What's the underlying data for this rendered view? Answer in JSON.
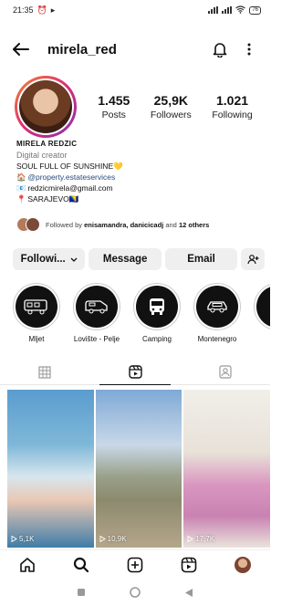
{
  "status_bar": {
    "time": "21:35",
    "battery": "76"
  },
  "header": {
    "username": "mirela_red"
  },
  "stats": [
    {
      "value": "1.455",
      "label": "Posts"
    },
    {
      "value": "25,9K",
      "label": "Followers"
    },
    {
      "value": "1.021",
      "label": "Following"
    }
  ],
  "bio": {
    "name": "MIRELA REDZIC",
    "category": "Digital creator",
    "tagline": "SOUL FULL OF SUNSHINE💛",
    "property_link": "@property.estateservices",
    "email": "redzicmirela@gmail.com",
    "location": "SARAJEVO🇧🇦"
  },
  "followed_by": {
    "prefix": "Followed by",
    "names": "enisamandra, danicicadj",
    "middle": "and",
    "others": "12 others"
  },
  "actions": {
    "following_label": "Followi...",
    "message_label": "Message",
    "email_label": "Email"
  },
  "highlights": [
    {
      "label": "Mljet"
    },
    {
      "label": "Lovište - Pelje"
    },
    {
      "label": "Camping"
    },
    {
      "label": "Montenegro"
    },
    {
      "label": ""
    }
  ],
  "grid": [
    {
      "views": "5,1K"
    },
    {
      "views": "10,9K"
    },
    {
      "views": "17,7K"
    }
  ],
  "icons": {
    "back": "arrow-left-icon",
    "bell": "bell-icon",
    "more": "more-vertical-icon",
    "add_person": "add-person-icon",
    "grid_tab": "grid-icon",
    "reels_tab": "reels-icon",
    "tagged_tab": "tagged-icon",
    "home": "home-icon",
    "search": "search-icon",
    "create": "plus-square-icon",
    "reels": "reels-icon"
  },
  "colors": {
    "accent_link": "#2b4c7e",
    "button_bg": "#efefef"
  }
}
